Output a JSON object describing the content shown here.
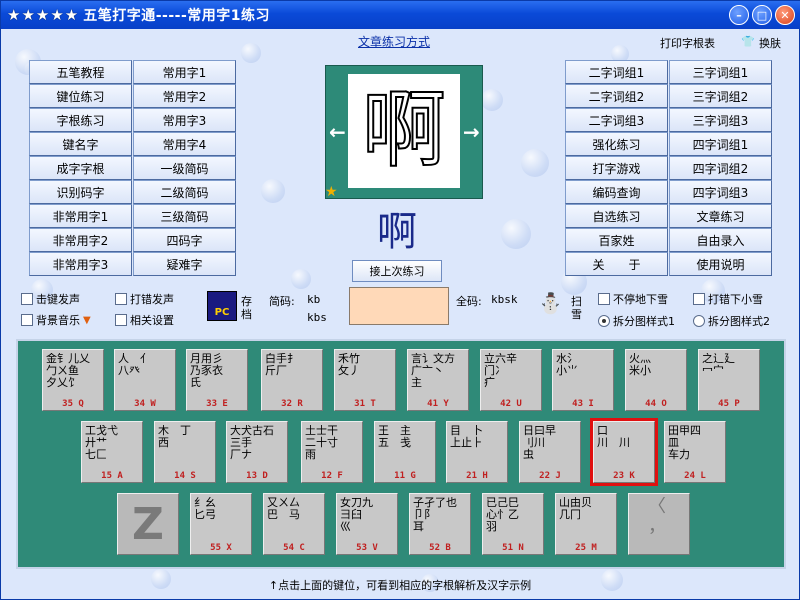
{
  "window": {
    "stars": "★★★★★",
    "title": "五笔打字通-----常用字1练习",
    "min": "–",
    "max": "□",
    "close": "✕"
  },
  "top": {
    "mode_link": "文章练习方式",
    "print_label": "打印字根表",
    "skin_label": "换肤"
  },
  "left_buttons": [
    "五笔教程",
    "常用字1",
    "键位练习",
    "常用字2",
    "字根练习",
    "常用字3",
    "键名字",
    "常用字4",
    "成字字根",
    "一级简码",
    "识别码字",
    "二级简码",
    "非常用字1",
    "三级简码",
    "非常用字2",
    "四码字",
    "非常用字3",
    "疑难字"
  ],
  "right_buttons": [
    "二字词组1",
    "三字词组1",
    "二字词组2",
    "三字词组2",
    "二字词组3",
    "三字词组3",
    "强化练习",
    "四字词组1",
    "打字游戏",
    "四字词组2",
    "编码查询",
    "四字词组3",
    "自选练习",
    "文章练习",
    "百家姓",
    "自由录入",
    "关　　于",
    "使用说明"
  ],
  "preview": {
    "char": "啊",
    "left_arrow": "←",
    "right_arrow": "→",
    "star": "★"
  },
  "current_char": "啊",
  "prev_button": "接上次练习",
  "options": {
    "key_sound": "击键发声",
    "error_sound": "打错发声",
    "bg_music": "背景音乐",
    "related_settings": "相关设置",
    "save_label": "存档",
    "disk_label": "PC",
    "no_big_snow": "不停地下雪",
    "small_snow": "打错下小雪",
    "sweep_snow": "扫雪",
    "split1": "拆分图样式1",
    "split2": "拆分图样式2"
  },
  "codes": {
    "short_label": "简码:",
    "short_value": "kb",
    "short_value2": "kbs",
    "full_label": "全码:",
    "full_value": "kbsk"
  },
  "keyboard": {
    "row1": [
      {
        "radicals": "金钅儿乂\n勹ㄨ鱼\n夕乂饣",
        "code": "35 Q"
      },
      {
        "radicals": "人　亻\n八癶",
        "code": "34 W"
      },
      {
        "radicals": "月用彡\n乃豕衣\n氏",
        "code": "33 E"
      },
      {
        "radicals": "白手扌\n斤厂",
        "code": "32 R"
      },
      {
        "radicals": "禾竹\n攵丿",
        "code": "31 T"
      },
      {
        "radicals": "言讠文方\n广亠丶\n主",
        "code": "41 Y"
      },
      {
        "radicals": "立六辛\n门冫\n疒",
        "code": "42 U"
      },
      {
        "radicals": "水氵\n小⺌",
        "code": "43 I"
      },
      {
        "radicals": "火灬\n米小",
        "code": "44 O"
      },
      {
        "radicals": "之辶廴\n冖宀",
        "code": "45 P"
      }
    ],
    "row2": [
      {
        "radicals": "工戈弋\n廾艹\n七匚",
        "code": "15 A"
      },
      {
        "radicals": "木　丁\n西",
        "code": "14 S"
      },
      {
        "radicals": "大犬古石\n三手\n厂ナ",
        "code": "13 D"
      },
      {
        "radicals": "土士干\n二十寸\n雨",
        "code": "12 F"
      },
      {
        "radicals": "王　主\n五　戋",
        "code": "11 G"
      },
      {
        "radicals": "目　卜\n上止⺊",
        "code": "21 H"
      },
      {
        "radicals": "日曰早\n刂川\n虫",
        "code": "22 J"
      },
      {
        "radicals": "口\n川　川",
        "code": "23 K"
      },
      {
        "radicals": "田甲四\n皿\n车力",
        "code": "24 L"
      }
    ],
    "row3": [
      {
        "radicals": "Z",
        "code": ""
      },
      {
        "radicals": "纟幺\n匕弓",
        "code": "55 X"
      },
      {
        "radicals": "又ㄨ厶\n巴　马",
        "code": "54 C"
      },
      {
        "radicals": "女刀九\n彐臼\n巛",
        "code": "53 V"
      },
      {
        "radicals": "子孑了也\n卩阝\n耳",
        "code": "52 B"
      },
      {
        "radicals": "已己巳\n心忄乙\n羽",
        "code": "51 N"
      },
      {
        "radicals": "山由贝\n几冂",
        "code": "25 M"
      },
      {
        "radicals": "〈\n，",
        "code": ""
      }
    ]
  },
  "hint": "↑点击上面的键位，可看到相应的字根解析及汉字示例"
}
